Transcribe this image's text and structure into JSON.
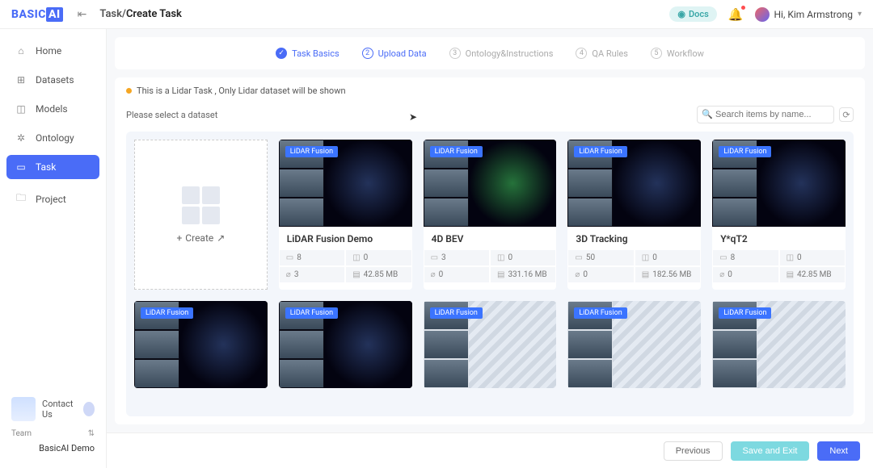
{
  "header": {
    "logo_text_a": "BASIC",
    "logo_text_b": "AI",
    "breadcrumb_root": "Task",
    "breadcrumb_sep": "/",
    "breadcrumb_current": "Create Task",
    "docs_label": "Docs",
    "user_greeting": "Hi, Kim Armstrong"
  },
  "sidebar": {
    "items": [
      {
        "icon": "⌂",
        "label": "Home"
      },
      {
        "icon": "⊞",
        "label": "Datasets"
      },
      {
        "icon": "◫",
        "label": "Models"
      },
      {
        "icon": "✲",
        "label": "Ontology"
      },
      {
        "icon": "▭",
        "label": "Task"
      },
      {
        "icon": "🗀",
        "label": "Project"
      }
    ],
    "contact_label": "Contact Us",
    "team_label": "Team",
    "team_name": "BasicAI Demo"
  },
  "stepper": [
    {
      "num": "✓",
      "label": "Task Basics",
      "state": "done"
    },
    {
      "num": "2",
      "label": "Upload Data",
      "state": "active"
    },
    {
      "num": "3",
      "label": "Ontology&Instructions",
      "state": ""
    },
    {
      "num": "4",
      "label": "QA Rules",
      "state": ""
    },
    {
      "num": "5",
      "label": "Workflow",
      "state": ""
    }
  ],
  "notice": "This is a Lidar Task , Only Lidar dataset will be shown",
  "prompt": "Please select a dataset",
  "search": {
    "placeholder": "Search items by name..."
  },
  "create_label": "Create",
  "tag_label": "LiDAR Fusion",
  "datasets_row1": [
    {
      "title": "LiDAR Fusion Demo",
      "stat_a": "8",
      "stat_b": "0",
      "stat_c": "3",
      "stat_d": "42.85 MB",
      "variant": ""
    },
    {
      "title": "4D BEV",
      "stat_a": "3",
      "stat_b": "0",
      "stat_c": "0",
      "stat_d": "331.16 MB",
      "variant": "green"
    },
    {
      "title": "3D Tracking",
      "stat_a": "50",
      "stat_b": "0",
      "stat_c": "0",
      "stat_d": "182.56 MB",
      "variant": ""
    },
    {
      "title": "Y*qT2",
      "stat_a": "8",
      "stat_b": "0",
      "stat_c": "0",
      "stat_d": "42.85 MB",
      "variant": ""
    }
  ],
  "datasets_row2_variants": [
    "",
    "",
    "gray",
    "gray",
    "gray"
  ],
  "footer": {
    "previous": "Previous",
    "save_exit": "Save and Exit",
    "next": "Next"
  }
}
